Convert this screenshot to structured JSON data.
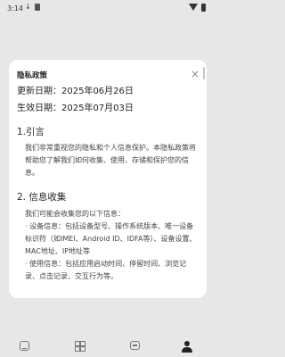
{
  "status_bar": {
    "time": "3:14",
    "download_icon": "↓",
    "icons": [
      "download-icon",
      "sd-card-icon",
      "wifi-icon",
      "battery-icon"
    ]
  },
  "dialog": {
    "title": "隐私政策",
    "close_symbol": "×",
    "updated_date": "更新日期：2025年06月26日",
    "effective_date": "生效日期：2025年07月03日",
    "sections": [
      {
        "heading": "1.引言",
        "body": "我们非常重视您的隐私和个人信息保护。本隐私政策将帮助您了解我们如何收集、使用、存储和保护您的信息。"
      },
      {
        "heading": "2. 信息收集",
        "lines": [
          "我们可能会收集您的以下信息：",
          "· 设备信息：包括设备型号、操作系统版本、唯一设备标识符（如IMEI、Android ID、IDFA等）、设备设置、MAC地址、IP地址等",
          "· 使用信息：包括应用启动时间、停留时间、浏览记录、点击记录、交互行为等。"
        ]
      }
    ]
  },
  "bottom_nav": {
    "items": [
      "home-tab",
      "apps-tab",
      "messages-tab",
      "profile-tab"
    ],
    "active": "profile-tab"
  },
  "colors": {
    "backdrop": "#e7e7e7",
    "dialog_bg": "#ffffff",
    "text_primary": "#222222",
    "text_body": "#444444"
  }
}
